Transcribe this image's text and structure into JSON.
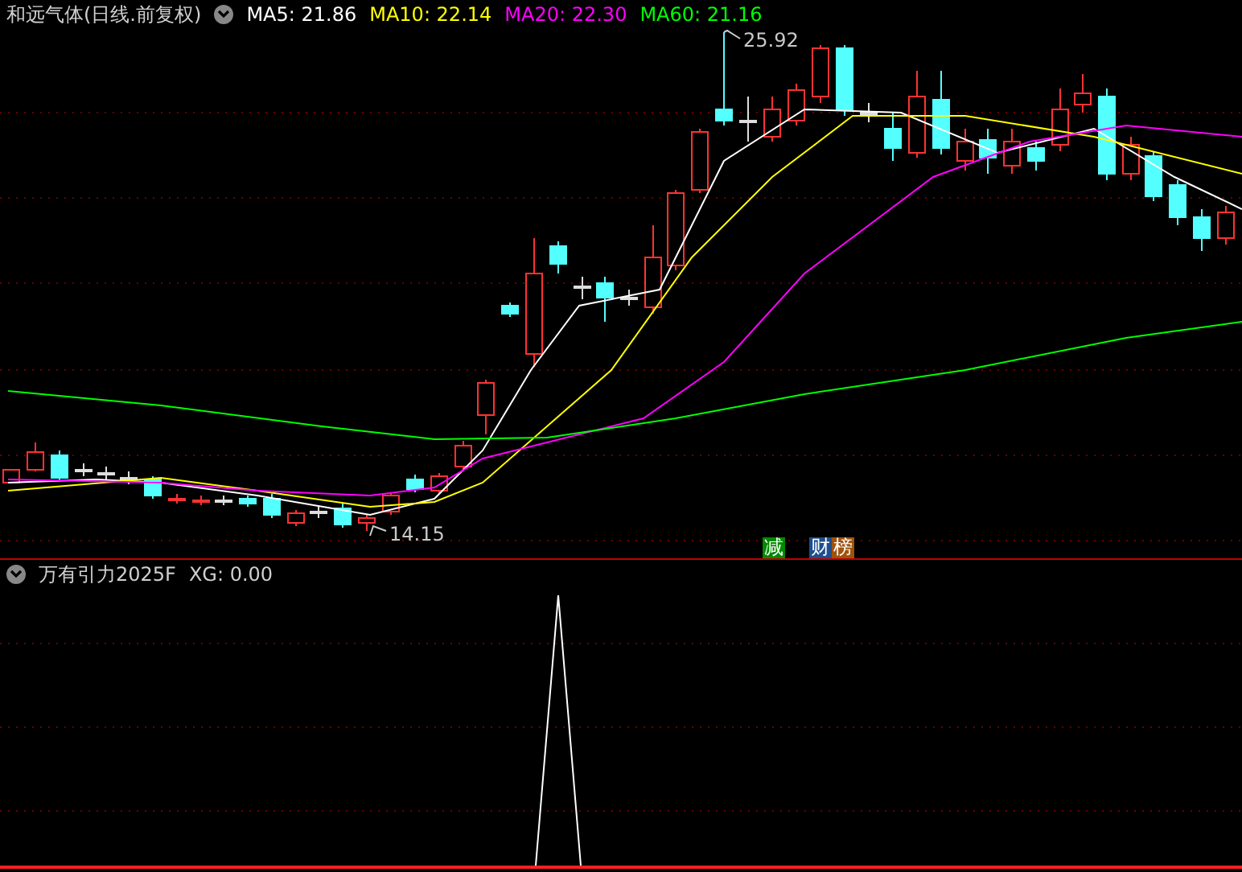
{
  "chart": {
    "title": "和远气体(日线.前复权)",
    "ma": [
      {
        "label": "MA5: 21.86",
        "color": "#ffffff"
      },
      {
        "label": "MA10: 22.14",
        "color": "#ffff00"
      },
      {
        "label": "MA20: 22.30",
        "color": "#ff00ff"
      },
      {
        "label": "MA60: 21.16",
        "color": "#00ff00"
      }
    ],
    "high_label": "25.92",
    "low_label": "14.15",
    "badges": [
      {
        "text": "减",
        "color": "#008a00"
      },
      {
        "text": "财",
        "color": "#1f4e8c"
      },
      {
        "text": "榜",
        "color": "#a0520c"
      }
    ]
  },
  "indicator": {
    "title": "万有引力2025F",
    "reading": "XG: 0.00"
  }
}
